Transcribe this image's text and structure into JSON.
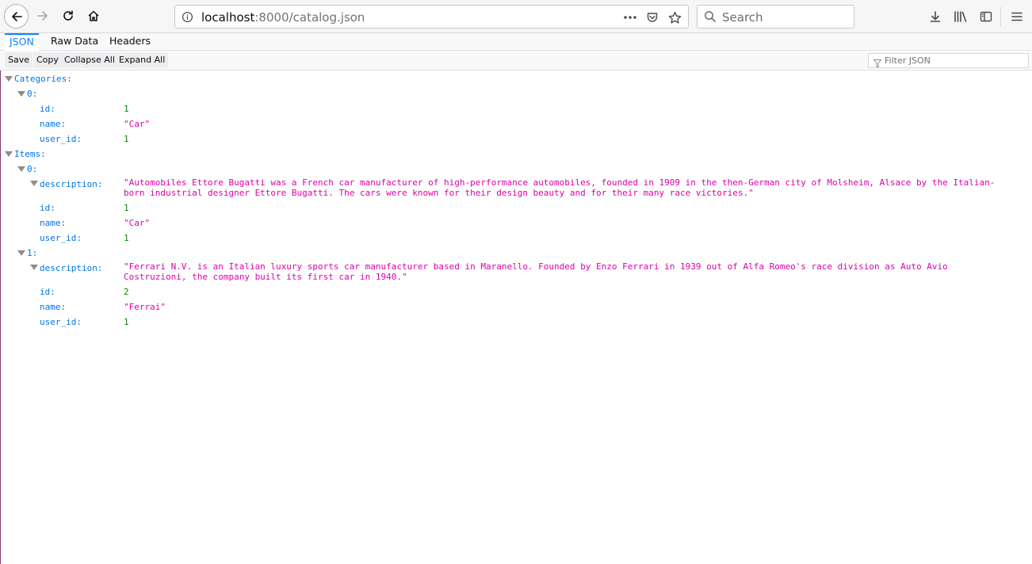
{
  "browser": {
    "url_host": "localhost",
    "url_path": ":8000/catalog.json",
    "search_placeholder": "Search"
  },
  "viewer": {
    "tabs": [
      "JSON",
      "Raw Data",
      "Headers"
    ],
    "active_tab": "JSON",
    "actions": [
      "Save",
      "Copy",
      "Collapse All",
      "Expand All"
    ],
    "filter_placeholder": "Filter JSON"
  },
  "tree": {
    "categories_key": "Categories:",
    "categories": [
      {
        "index": "0:",
        "id_key": "id:",
        "id": "1",
        "name_key": "name:",
        "name": "\"Car\"",
        "user_id_key": "user_id:",
        "user_id": "1"
      }
    ],
    "items_key": "Items:",
    "items": [
      {
        "index": "0:",
        "description_key": "description:",
        "description": "\"Automobiles Ettore Bugatti was a French car manufacturer of high-performance automobiles, founded in 1909 in the then-German city of Molsheim, Alsace by the Italian-born industrial designer Ettore Bugatti. The cars were known for their design beauty and for their many race victories.\"",
        "id_key": "id:",
        "id": "1",
        "name_key": "name:",
        "name": "\"Car\"",
        "user_id_key": "user_id:",
        "user_id": "1"
      },
      {
        "index": "1:",
        "description_key": "description:",
        "description": "\"Ferrari N.V. is an Italian luxury sports car manufacturer based in Maranello. Founded by Enzo Ferrari in 1939 out of Alfa Romeo's race division as Auto Avio Costruzioni, the company built its first car in 1940.\"",
        "id_key": "id:",
        "id": "2",
        "name_key": "name:",
        "name": "\"Ferrai\"",
        "user_id_key": "user_id:",
        "user_id": "1"
      }
    ]
  },
  "colors": {
    "key": "#0074e8",
    "string": "#dd00a9",
    "number": "#058b00",
    "accent": "#0a84ff"
  }
}
